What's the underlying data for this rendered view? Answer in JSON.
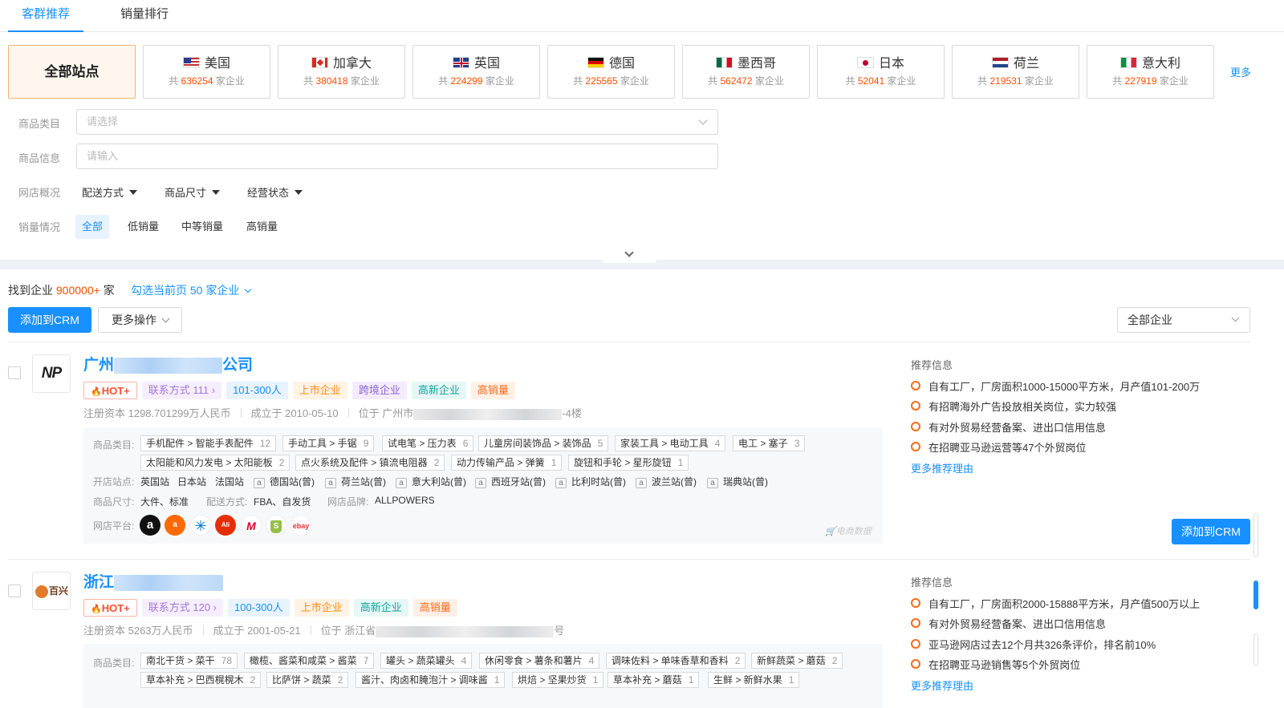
{
  "tabs": [
    {
      "label": "客群推荐",
      "active": true
    },
    {
      "label": "销量排行",
      "active": false
    }
  ],
  "sites": {
    "all_label": "全部站点",
    "items": [
      {
        "name": "美国",
        "prefix": "共",
        "count": "636254",
        "suffix": "家企业",
        "flag": "us"
      },
      {
        "name": "加拿大",
        "prefix": "共",
        "count": "380418",
        "suffix": "家企业",
        "flag": "ca"
      },
      {
        "name": "英国",
        "prefix": "共",
        "count": "224299",
        "suffix": "家企业",
        "flag": "gb"
      },
      {
        "name": "德国",
        "prefix": "共",
        "count": "225565",
        "suffix": "家企业",
        "flag": "de"
      },
      {
        "name": "墨西哥",
        "prefix": "共",
        "count": "562472",
        "suffix": "家企业",
        "flag": "mx"
      },
      {
        "name": "日本",
        "prefix": "共",
        "count": "52041",
        "suffix": "家企业",
        "flag": "jp"
      },
      {
        "name": "荷兰",
        "prefix": "共",
        "count": "219531",
        "suffix": "家企业",
        "flag": "nl"
      },
      {
        "name": "意大利",
        "prefix": "共",
        "count": "227919",
        "suffix": "家企业",
        "flag": "it"
      }
    ],
    "more": "更多"
  },
  "filters": {
    "category_label": "商品类目",
    "category_placeholder": "请选择",
    "info_label": "商品信息",
    "info_placeholder": "请输入",
    "shop_label": "网店概况",
    "shop_dropdowns": [
      "配送方式",
      "商品尺寸",
      "经营状态"
    ],
    "sales_label": "销量情况",
    "sales_options": [
      "全部",
      "低销量",
      "中等销量",
      "高销量"
    ]
  },
  "results": {
    "found_prefix": "找到企业",
    "found_count": "900000+",
    "found_suffix": "家",
    "select_page": "勾选当前页 50 家企业",
    "add_crm": "添加到CRM",
    "more_ops": "更多操作",
    "scope": "全部企业"
  },
  "companies": [
    {
      "name_start": "广州",
      "name_end": "公司",
      "tags": {
        "hot": "HOT+",
        "phone": "联系方式 111",
        "size": "101-300人",
        "ipo": "上市企业",
        "cross": "跨境企业",
        "new": "高新企业",
        "sale": "高销量"
      },
      "capital": "注册资本 1298.701299万人民币",
      "founded": "成立于 2010-05-10",
      "addr_start": "位于 广州市",
      "addr_end": "-4楼",
      "category_label": "商品类目:",
      "categories": [
        {
          "name": "手机配件 > 智能手表配件",
          "n": "12"
        },
        {
          "name": "手动工具 > 手锯",
          "n": "9"
        },
        {
          "name": "试电笔 > 压力表",
          "n": "6"
        },
        {
          "name": "儿童房间装饰品 > 装饰品",
          "n": "5"
        },
        {
          "name": "家装工具 > 电动工具",
          "n": "4"
        },
        {
          "name": "电工 > 塞子",
          "n": "3"
        },
        {
          "name": "太阳能和风力发电 > 太阳能板",
          "n": "2"
        },
        {
          "name": "点火系统及配件 > 镇流电阻器",
          "n": "2"
        },
        {
          "name": "动力传输产品 > 弹簧",
          "n": "1"
        },
        {
          "name": "旋钮和手轮 > 星形旋钮",
          "n": "1"
        }
      ],
      "stations_label": "开店站点:",
      "stations": [
        "英国站",
        "日本站",
        "法国站",
        "德国站(曾)",
        "荷兰站(曾)",
        "意大利站(曾)",
        "西班牙站(曾)",
        "比利时站(曾)",
        "波兰站(曾)",
        "瑞典站(曾)"
      ],
      "size_label": "商品尺寸:",
      "size": "大件、标准",
      "ship_label": "配送方式:",
      "ship": "FBA、自发货",
      "brand_label": "网店品牌:",
      "brand": "ALLPOWERS",
      "platform_label": "网店平台:",
      "ecom_data": "电商数据",
      "rec_title": "推荐信息",
      "recs": [
        "自有工厂，厂房面积1000-15000平方米，月产值101-200万",
        "有招聘海外广告投放相关岗位，实力较强",
        "有对外贸易经营备案、进出口信用信息",
        "在招聘亚马逊运营等47个外贸岗位"
      ],
      "rec_more": "更多推荐理由",
      "add_crm": "添加到CRM"
    },
    {
      "name_start": "浙江",
      "tags": {
        "hot": "HOT+",
        "phone": "联系方式 120",
        "size": "100-300人",
        "ipo": "上市企业",
        "new": "高新企业",
        "sale": "高销量"
      },
      "capital": "注册资本 5263万人民币",
      "founded": "成立于 2001-05-21",
      "addr_start": "位于 浙江省",
      "addr_end": "号",
      "category_label": "商品类目:",
      "categories": [
        {
          "name": "南北干货 > 菜干",
          "n": "78"
        },
        {
          "name": "橄榄、酱菜和咸菜 > 酱菜",
          "n": "7"
        },
        {
          "name": "罐头 > 蔬菜罐头",
          "n": "4"
        },
        {
          "name": "休闲零食 > 薯条和薯片",
          "n": "4"
        },
        {
          "name": "调味佐料 > 单味香草和香料",
          "n": "2"
        },
        {
          "name": "新鲜蔬菜 > 蘑菇",
          "n": "2"
        },
        {
          "name": "草本补充 > 巴西榥榥木",
          "n": "2"
        },
        {
          "name": "比萨饼 > 蔬菜",
          "n": "2"
        },
        {
          "name": "酱汁、肉卤和腌泡汁 > 调味酱",
          "n": "1"
        },
        {
          "name": "烘焙 > 坚果炒货",
          "n": "1"
        },
        {
          "name": "草本补充 > 蘑菇",
          "n": "1"
        },
        {
          "name": "生鲜 > 新鲜水果",
          "n": "1"
        }
      ],
      "rec_title": "推荐信息",
      "recs": [
        "自有工厂，厂房面积2000-15888平方米，月产值500万以上",
        "有对外贸易经营备案、进出口信用信息",
        "亚马逊网店过去12个月共326条评价，排名前10%",
        "在招聘亚马逊销售等5个外贸岗位"
      ],
      "rec_more": "更多推荐理由"
    }
  ],
  "colors": {
    "primary": "#1890ff",
    "accent": "#fa6b16",
    "count": "#ff4d00"
  }
}
